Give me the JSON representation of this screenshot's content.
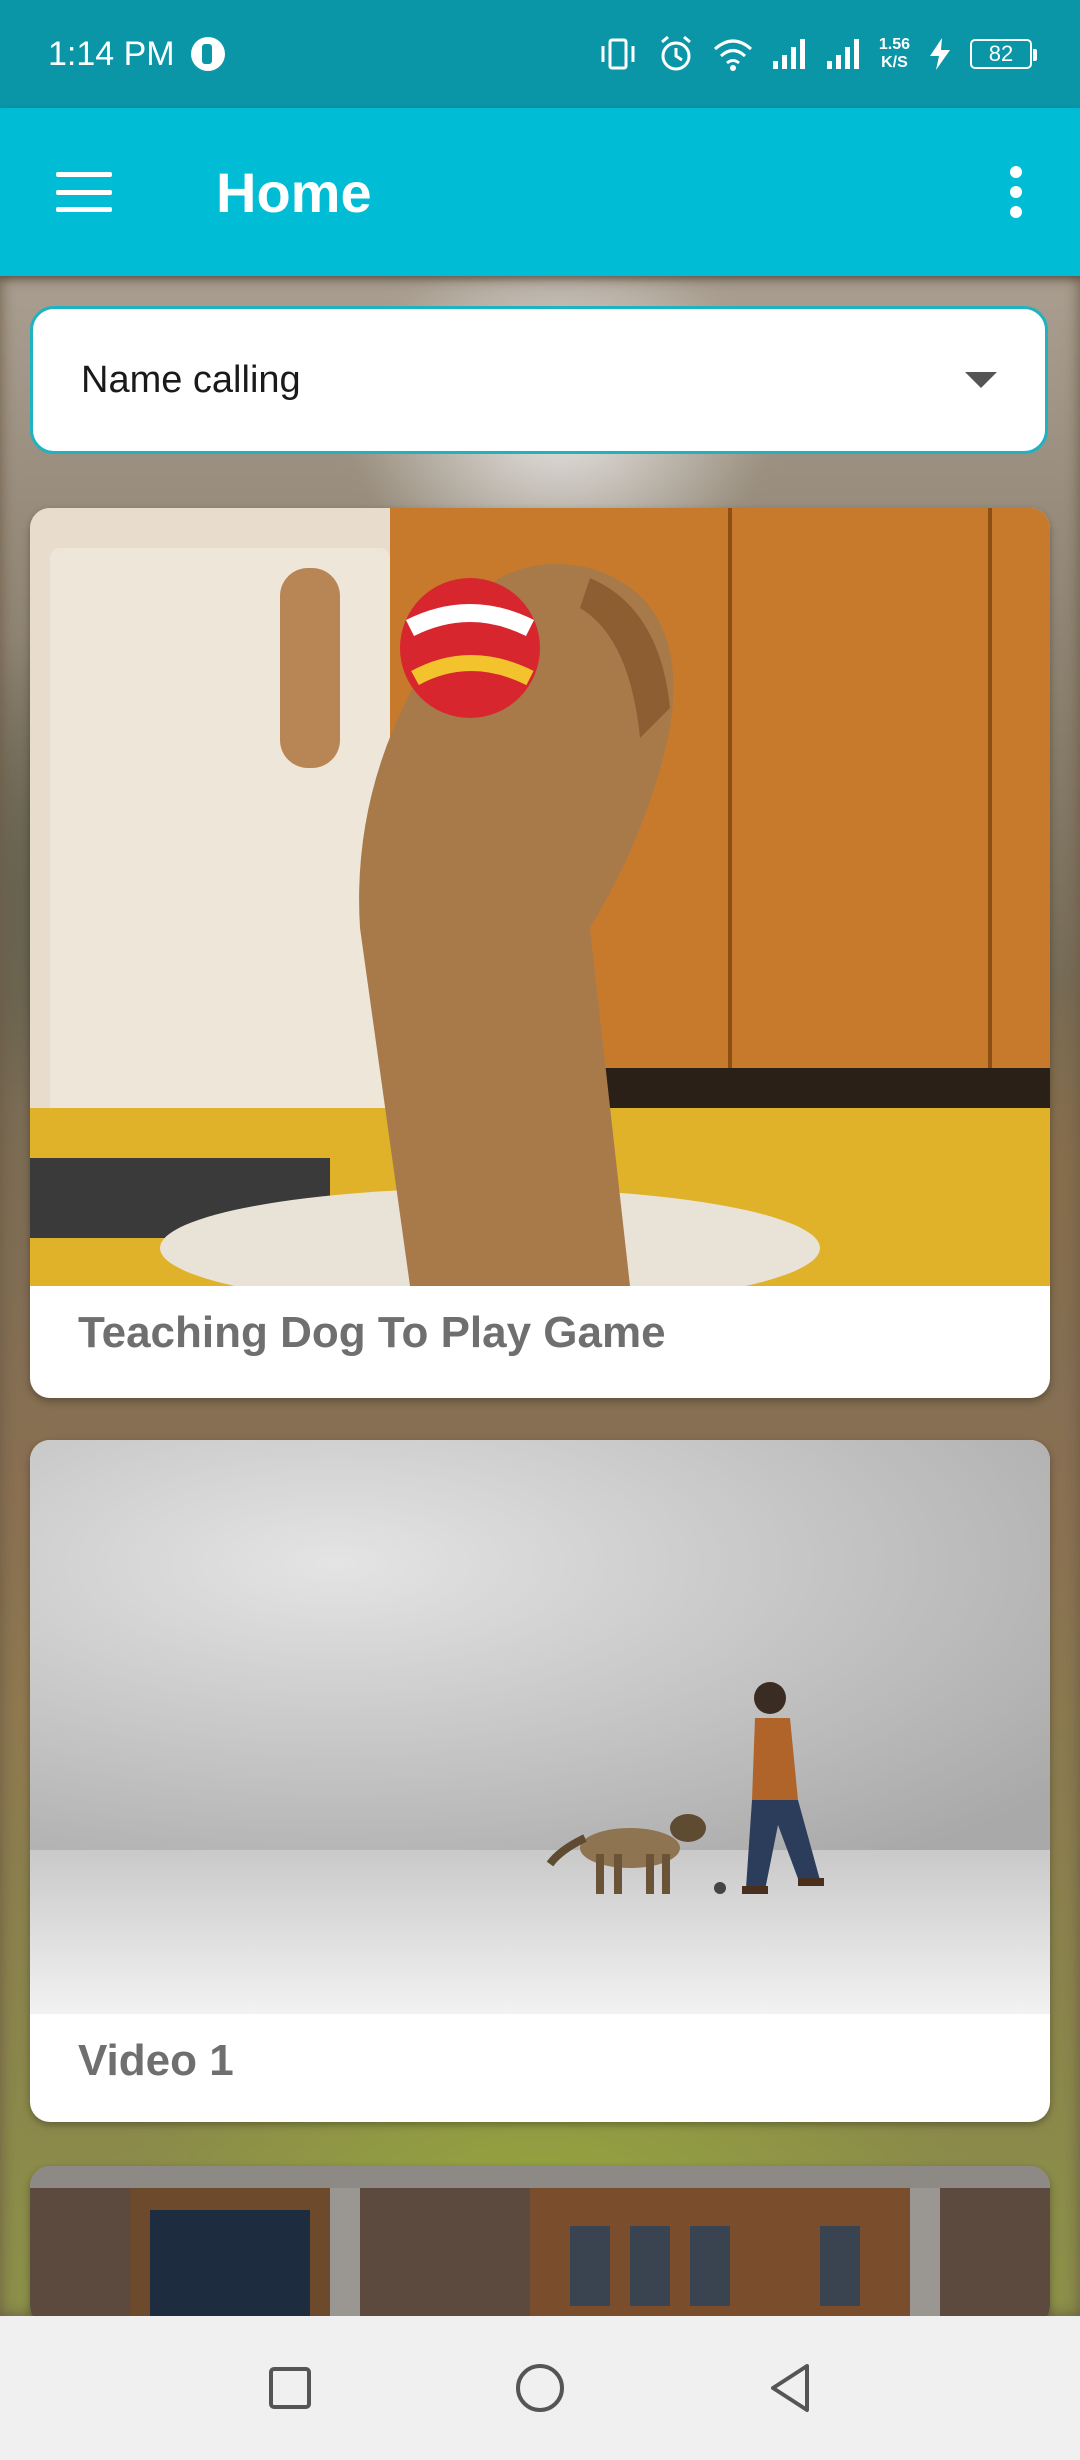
{
  "status_bar": {
    "time": "1:14 PM",
    "net_speed_value": "1.56",
    "net_speed_unit": "K/S",
    "battery": "82",
    "icons": [
      "vibrate-icon",
      "alarm-icon",
      "wifi-icon",
      "signal-icon",
      "signal-icon",
      "charging-icon"
    ]
  },
  "app_bar": {
    "title": "Home"
  },
  "filter": {
    "selected": "Name calling"
  },
  "videos": [
    {
      "title": "Teaching Dog To Play Game"
    },
    {
      "title": "Video 1"
    },
    {
      "title": ""
    }
  ],
  "colors": {
    "status_bar": "#0a96a6",
    "app_bar": "#00bcd4",
    "dropdown_border": "#1fb3c2",
    "card_title": "#6f6f6f"
  }
}
